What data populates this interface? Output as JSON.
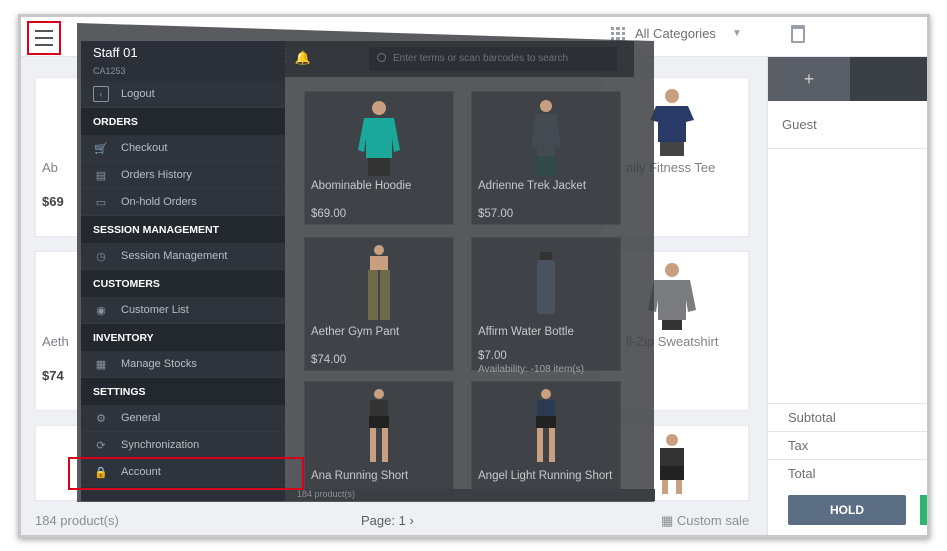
{
  "header": {
    "category_select": "All Categories"
  },
  "sidebar": {
    "staff_name": "Staff 01",
    "staff_id": "CA1253",
    "logout_label": "Logout",
    "sections": [
      {
        "title": "ORDERS",
        "items": [
          {
            "label": "Checkout",
            "icon": "cart-icon"
          },
          {
            "label": "Orders History",
            "icon": "list-icon"
          },
          {
            "label": "On-hold Orders",
            "icon": "box-icon"
          }
        ]
      },
      {
        "title": "SESSION MANAGEMENT",
        "items": [
          {
            "label": "Session Management",
            "icon": "clock-icon"
          }
        ]
      },
      {
        "title": "CUSTOMERS",
        "items": [
          {
            "label": "Customer List",
            "icon": "user-icon"
          }
        ]
      },
      {
        "title": "INVENTORY",
        "items": [
          {
            "label": "Manage Stocks",
            "icon": "calendar-icon"
          }
        ]
      },
      {
        "title": "SETTINGS",
        "items": [
          {
            "label": "General",
            "icon": "gear-icon"
          },
          {
            "label": "Synchronization",
            "icon": "sync-icon"
          },
          {
            "label": "Account",
            "icon": "lock-icon"
          }
        ]
      }
    ]
  },
  "search": {
    "placeholder": "Enter terms or scan barcodes to search"
  },
  "products": [
    {
      "name": "Abominable Hoodie",
      "price": "$69.00"
    },
    {
      "name": "Adrienne Trek Jacket",
      "price": "$57.00"
    },
    {
      "name": "Aether Gym Pant",
      "price": "$74.00"
    },
    {
      "name": "Affirm Water Bottle",
      "price": "$7.00",
      "availability": "Availability: -108 item(s)"
    },
    {
      "name": "Ana Running Short",
      "price": ""
    },
    {
      "name": "Angel Light Running Short",
      "price": ""
    }
  ],
  "background_products": {
    "left_name_1": "Ab",
    "left_price_1": "$69",
    "left_name_2": "Aeth",
    "left_price_2": "$74",
    "right_name_1": "aily Fitness Tee",
    "right_name_2": "ll-Zip Sweatshirt"
  },
  "cart": {
    "customer": "Guest",
    "subtotal_label": "Subtotal",
    "tax_label": "Tax",
    "total_label": "Total",
    "hold_label": "HOLD"
  },
  "footer": {
    "product_count": "184 product(s)",
    "page_label": "Page: 1",
    "custom_sale": "Custom sale",
    "overlay_count": "184 product(s)"
  },
  "colors": {
    "highlight": "#d9001b",
    "sidebar_bg": "#2b3038",
    "hold_button": "#5b6e84"
  }
}
